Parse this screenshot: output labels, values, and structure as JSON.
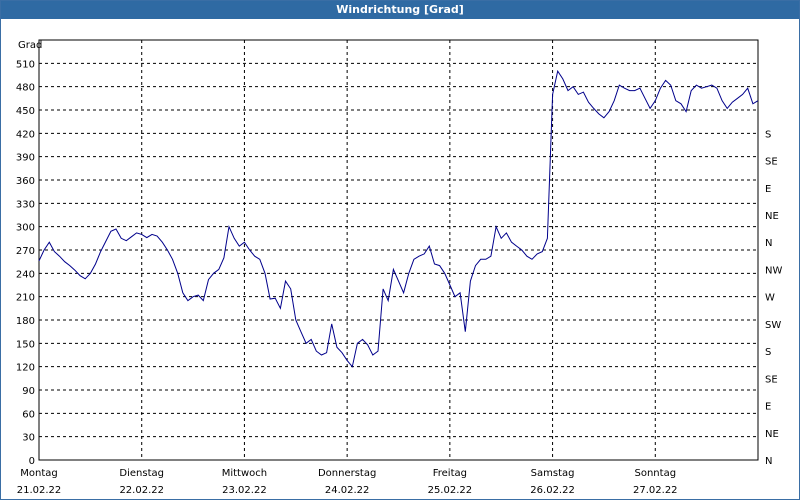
{
  "window": {
    "title": "Windrichtung [Grad]"
  },
  "chart_data": {
    "type": "line",
    "title": "Windrichtung [Grad]",
    "ylabel": "Grad",
    "ylim": [
      0,
      540
    ],
    "yticks": [
      0,
      30,
      60,
      90,
      120,
      150,
      180,
      210,
      240,
      270,
      300,
      330,
      360,
      390,
      420,
      450,
      480,
      510
    ],
    "right_axis_labels": [
      "N",
      "NE",
      "E",
      "SE",
      "S",
      "SW",
      "W",
      "NW",
      "N",
      "NE",
      "E",
      "SE",
      "S"
    ],
    "x_days": [
      {
        "day": "Montag",
        "date": "21.02.22"
      },
      {
        "day": "Dienstag",
        "date": "22.02.22"
      },
      {
        "day": "Mittwoch",
        "date": "23.02.22"
      },
      {
        "day": "Donnerstag",
        "date": "24.02.22"
      },
      {
        "day": "Freitag",
        "date": "25.02.22"
      },
      {
        "day": "Samstag",
        "date": "26.02.22"
      },
      {
        "day": "Sonntag",
        "date": "27.02.22"
      }
    ],
    "xlim": [
      0,
      7
    ],
    "grid": true,
    "line_color": "#00008b",
    "series": [
      {
        "x": [
          0,
          0.05,
          0.1,
          0.15,
          0.2,
          0.25,
          0.3,
          0.35,
          0.4,
          0.45,
          0.5,
          0.55,
          0.6,
          0.7,
          0.75,
          0.8,
          0.85,
          0.9,
          0.95,
          1.0,
          1.05,
          1.1,
          1.15,
          1.2,
          1.25,
          1.3,
          1.35,
          1.4,
          1.45,
          1.5,
          1.55,
          1.6,
          1.65,
          1.7,
          1.75,
          1.8,
          1.85,
          1.9,
          1.95,
          2.0,
          2.05,
          2.1,
          2.15,
          2.2,
          2.25,
          2.3,
          2.35,
          2.4,
          2.45,
          2.5,
          2.55,
          2.6,
          2.65,
          2.7,
          2.75,
          2.8,
          2.85,
          2.9,
          2.95,
          3.0,
          3.05,
          3.1,
          3.15,
          3.2,
          3.25,
          3.3,
          3.35,
          3.4,
          3.45,
          3.5,
          3.55,
          3.6,
          3.65,
          3.7,
          3.75,
          3.8,
          3.85,
          3.9,
          3.95,
          4.0,
          4.05,
          4.1,
          4.15,
          4.2,
          4.25,
          4.3,
          4.35,
          4.4,
          4.45,
          4.5,
          4.55,
          4.6,
          4.65,
          4.7,
          4.75,
          4.8,
          4.85,
          4.9,
          4.95,
          5.0,
          5.05,
          5.1,
          5.15,
          5.2,
          5.25,
          5.3,
          5.35,
          5.4,
          5.45,
          5.5,
          5.55,
          5.6,
          5.65,
          5.7,
          5.75,
          5.8,
          5.85,
          5.9,
          5.95,
          6.0,
          6.05,
          6.1,
          6.15,
          6.2,
          6.25,
          6.3,
          6.35,
          6.4,
          6.45,
          6.5,
          6.55,
          6.6,
          6.65,
          6.7,
          6.75,
          6.8,
          6.85,
          6.9,
          6.95,
          7.0
        ],
        "values": [
          256,
          270,
          280,
          268,
          262,
          255,
          250,
          244,
          237,
          233,
          240,
          252,
          268,
          294,
          297,
          285,
          282,
          287,
          292,
          290,
          286,
          290,
          288,
          280,
          270,
          258,
          240,
          215,
          205,
          210,
          212,
          205,
          232,
          240,
          245,
          260,
          300,
          285,
          275,
          280,
          270,
          262,
          258,
          240,
          207,
          208,
          195,
          230,
          220,
          180,
          165,
          150,
          155,
          140,
          135,
          138,
          175,
          145,
          138,
          128,
          120,
          150,
          155,
          148,
          135,
          140,
          220,
          205,
          245,
          230,
          215,
          240,
          258,
          262,
          265,
          275,
          252,
          250,
          240,
          225,
          210,
          215,
          165,
          230,
          250,
          258,
          258,
          262,
          300,
          285,
          292,
          280,
          275,
          270,
          262,
          258,
          265,
          268,
          285,
          470,
          500,
          490,
          475,
          480,
          470,
          473,
          460,
          452,
          445,
          440,
          448,
          462,
          482,
          478,
          475,
          475,
          478,
          465,
          452,
          462,
          478,
          488,
          482,
          462,
          458,
          448,
          475,
          482,
          478,
          480,
          482,
          478,
          462,
          452,
          460,
          465,
          470,
          478,
          458,
          462
        ]
      }
    ]
  }
}
